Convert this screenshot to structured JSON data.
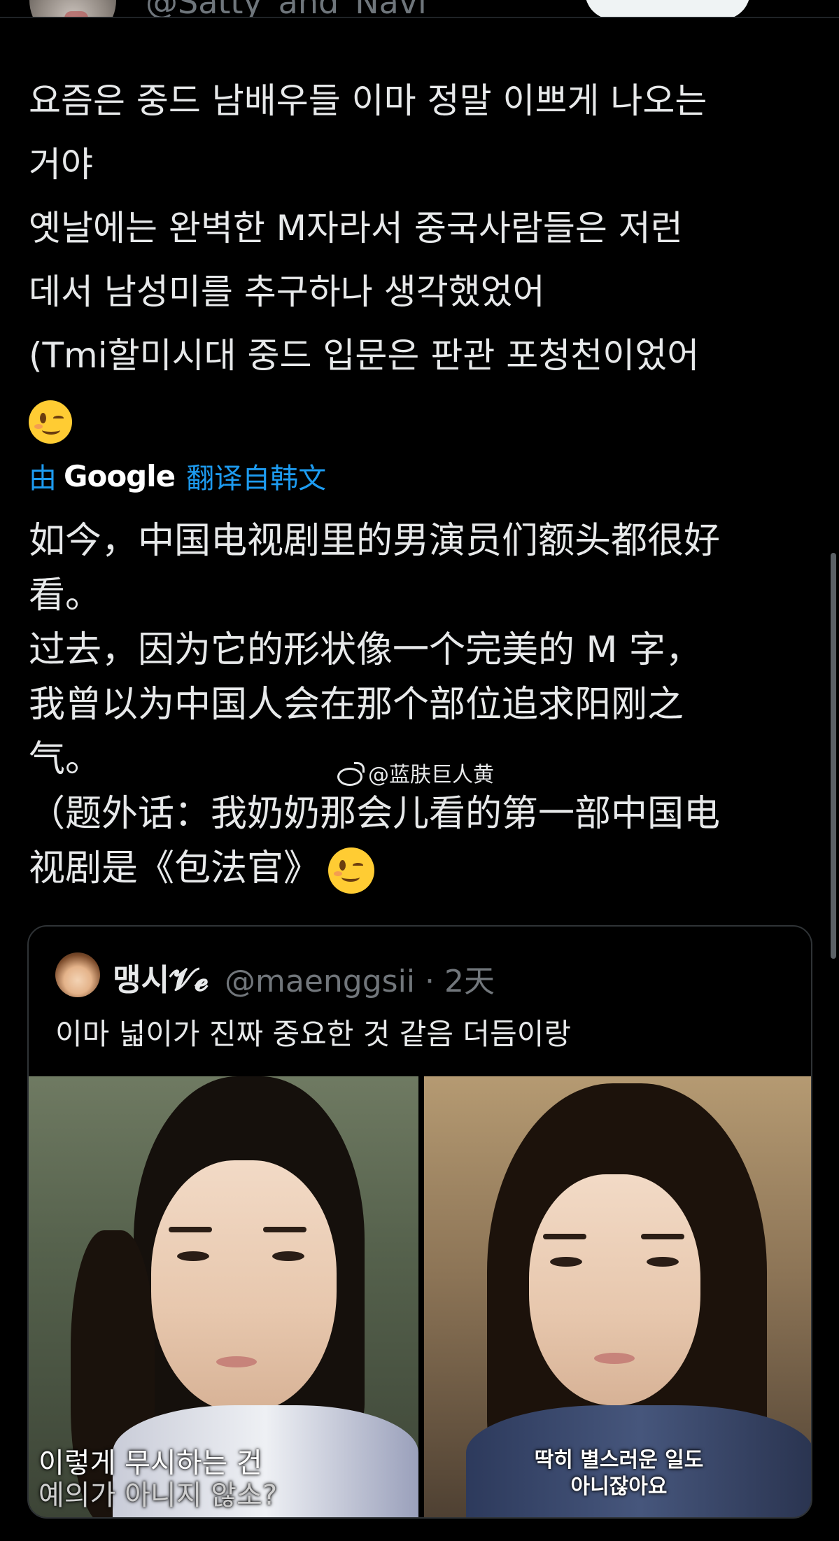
{
  "header": {
    "author_handle": "@Satty_and_Navi"
  },
  "tweet": {
    "lines": [
      "요즘은 중드 남배우들 이마 정말 이쁘게 나오는",
      "거야",
      "옛날에는 완벽한 M자라서 중국사람들은 저런",
      "데서 남성미를 추구하나 생각했었어",
      "(Tmi할미시대 중드 입문은 판관 포청천이었어"
    ],
    "emoji": "winking-face"
  },
  "translation": {
    "by_prefix": "由",
    "provider": "Google",
    "label": "翻译自韩文",
    "lines": [
      "如今，中国电视剧里的男演员们额头都很好",
      "看。",
      "过去，因为它的形状像一个完美的 M 字，",
      "我曾以为中国人会在那个部位追求阳刚之",
      "气。",
      "（题外话：我奶奶那会儿看的第一部中国电",
      "视剧是《包法官》"
    ]
  },
  "watermark": {
    "text": "@蓝肤巨人黄"
  },
  "quoted_tweet": {
    "name": "맹시𝓥𝓮",
    "handle_time": "@maenggsii · 2天",
    "text": "이마 넓이가 진짜 중요한 것 같음 더듬이랑",
    "images": [
      {
        "subtitle_lines": [
          "이렇게 무시하는 건",
          "예의가 아니지 않소?"
        ]
      },
      {
        "subtitle_lines": [
          "딱히 별스러운 일도",
          "아니잖아요"
        ]
      }
    ]
  },
  "colors": {
    "background": "#000000",
    "text": "#e7e9ea",
    "muted": "#71767b",
    "link": "#1d9bf0",
    "border": "#2f3336"
  }
}
